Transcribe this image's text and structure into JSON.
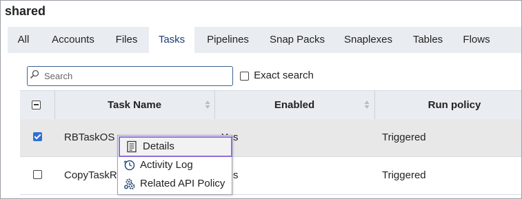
{
  "title": "shared",
  "tabs": [
    {
      "label": "All"
    },
    {
      "label": "Accounts"
    },
    {
      "label": "Files"
    },
    {
      "label": "Tasks",
      "active": true
    },
    {
      "label": "Pipelines"
    },
    {
      "label": "Snap Packs"
    },
    {
      "label": "Snaplexes"
    },
    {
      "label": "Tables"
    },
    {
      "label": "Flows"
    }
  ],
  "search": {
    "placeholder": "Search",
    "value": ""
  },
  "exact_search": {
    "label": "Exact search",
    "checked": false
  },
  "table": {
    "columns": [
      "Task Name",
      "Enabled",
      "Run policy"
    ],
    "rows": [
      {
        "name": "RBTaskOS",
        "enabled": "Yes",
        "run_policy": "Triggered",
        "checked": true
      },
      {
        "name": "CopyTaskRe",
        "enabled": "Yes",
        "run_policy": "Triggered",
        "checked": false
      }
    ]
  },
  "context_menu": {
    "items": [
      "Details",
      "Activity Log",
      "Related API Policy"
    ]
  },
  "colors": {
    "accent": "#1b3c73",
    "highlight": "#8e6fd8",
    "checkbox": "#2f6fd3"
  }
}
